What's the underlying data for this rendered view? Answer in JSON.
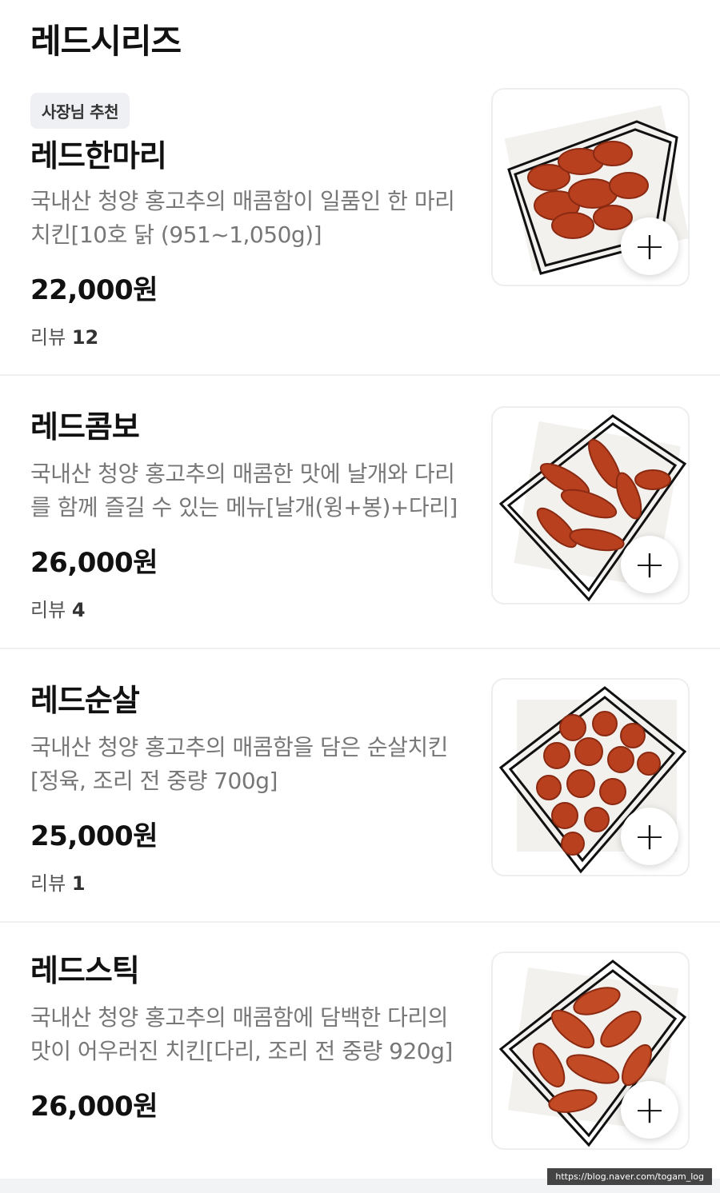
{
  "section": {
    "title": "레드시리즈"
  },
  "items": [
    {
      "badge": "사장님 추천",
      "name": "레드한마리",
      "desc": "국내산 청양 홍고추의 매콤함이 일품인 한 마리 치킨[10호 닭 (951~1,050g)]",
      "price": "22,000원",
      "review_label": "리뷰",
      "review_count": "12",
      "add_label": "+"
    },
    {
      "name": "레드콤보",
      "desc": "국내산 청양 홍고추의 매콤한 맛에 날개와 다리를 함께 즐길 수 있는 메뉴[날개(윙+봉)+다리]",
      "price": "26,000원",
      "review_label": "리뷰",
      "review_count": "4",
      "add_label": "+"
    },
    {
      "name": "레드순살",
      "desc": "국내산 청양 홍고추의 매콤함을 담은 순살치킨[정육, 조리 전 중량 700g]",
      "price": "25,000원",
      "review_label": "리뷰",
      "review_count": "1",
      "add_label": "+"
    },
    {
      "name": "레드스틱",
      "desc": "국내산 청양 홍고추의 매콤함에 담백한 다리의 맛이 어우러진 치킨[다리, 조리 전 중량 920g]",
      "price": "26,000원",
      "add_label": "+"
    }
  ],
  "watermark": "https://blog.naver.com/togam_log",
  "colors": {
    "chicken": "#b8401f",
    "chicken_dark": "#8a2a12",
    "paper": "#f3f1ee",
    "basket": "#111111"
  }
}
